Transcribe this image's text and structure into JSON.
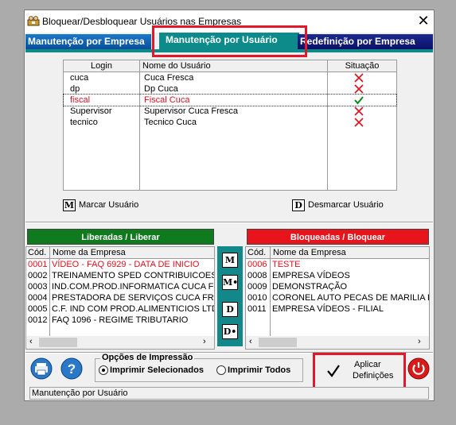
{
  "window": {
    "title": "Bloquear/Desbloquear Usuários nas Empresas"
  },
  "tabs": [
    {
      "label": "Manutenção por Empresa"
    },
    {
      "label": "Manutenção por Usuário"
    },
    {
      "label": "Redefinição por Empresa"
    }
  ],
  "users_grid": {
    "headers": {
      "login": "Login",
      "name": "Nome do Usuário",
      "status": "Situação"
    },
    "rows": [
      {
        "login": "cuca",
        "name": "Cuca Fresca",
        "status": "blocked"
      },
      {
        "login": "dp",
        "name": "Dp Cuca",
        "status": "blocked"
      },
      {
        "login": "fiscal",
        "name": "Fiscal Cuca",
        "status": "allowed"
      },
      {
        "login": "Supervisor",
        "name": "Supervisor Cuca Fresca",
        "status": "blocked"
      },
      {
        "login": "tecnico",
        "name": "Tecnico Cuca",
        "status": "blocked"
      }
    ]
  },
  "user_actions": {
    "mark_key": "M",
    "mark_label": "Marcar Usuário",
    "unmark_key": "D",
    "unmark_label": "Desmarcar Usuário"
  },
  "liberadas": {
    "title": "Liberadas / Liberar",
    "headers": {
      "code": "Cód.",
      "name": "Nome da Empresa"
    },
    "rows": [
      {
        "code": "0001",
        "name": "VÍDEO - FAQ 6929 -  DATA DE INICIO"
      },
      {
        "code": "0002",
        "name": "TREINAMENTO SPED CONTRIBUICOES"
      },
      {
        "code": "0003",
        "name": "IND.COM.PROD.INFORMATICA CUCA FR"
      },
      {
        "code": "0004",
        "name": "PRESTADORA DE SERVIÇOS CUCA FR"
      },
      {
        "code": "0005",
        "name": "C.F. IND COM PROD.ALIMENTICIOS LTD"
      },
      {
        "code": "0012",
        "name": "FAQ 1096 - REGIME TRIBUTARIO"
      }
    ]
  },
  "bloqueadas": {
    "title": "Bloqueadas / Bloquear",
    "headers": {
      "code": "Cód.",
      "name": "Nome da Empresa"
    },
    "rows": [
      {
        "code": "0006",
        "name": "TESTE"
      },
      {
        "code": "0008",
        "name": "EMPRESA VÍDEOS"
      },
      {
        "code": "0009",
        "name": "DEMONSTRAÇÃO"
      },
      {
        "code": "0010",
        "name": "CORONEL AUTO PECAS DE MARILIA LTD"
      },
      {
        "code": "0011",
        "name": "EMPRESA VÍDEOS - FILIAL"
      }
    ]
  },
  "transfer_buttons": [
    "M",
    "M•",
    "D",
    "D•"
  ],
  "print_options": {
    "title": "Opções de Impressão",
    "selected_label": "Imprimir Selecionados",
    "all_label": "Imprimir Todos",
    "selected": "Imprimir Selecionados"
  },
  "apply_button": {
    "line1": "Aplicar",
    "line2": "Definições"
  },
  "status_bar": {
    "text": "Manutenção por Usuário"
  },
  "colors": {
    "accent_teal": "#0d8b8b",
    "liberadas_green": "#0f7a1e",
    "bloqueadas_red": "#e8141c",
    "highlight_red": "#e4162a"
  }
}
